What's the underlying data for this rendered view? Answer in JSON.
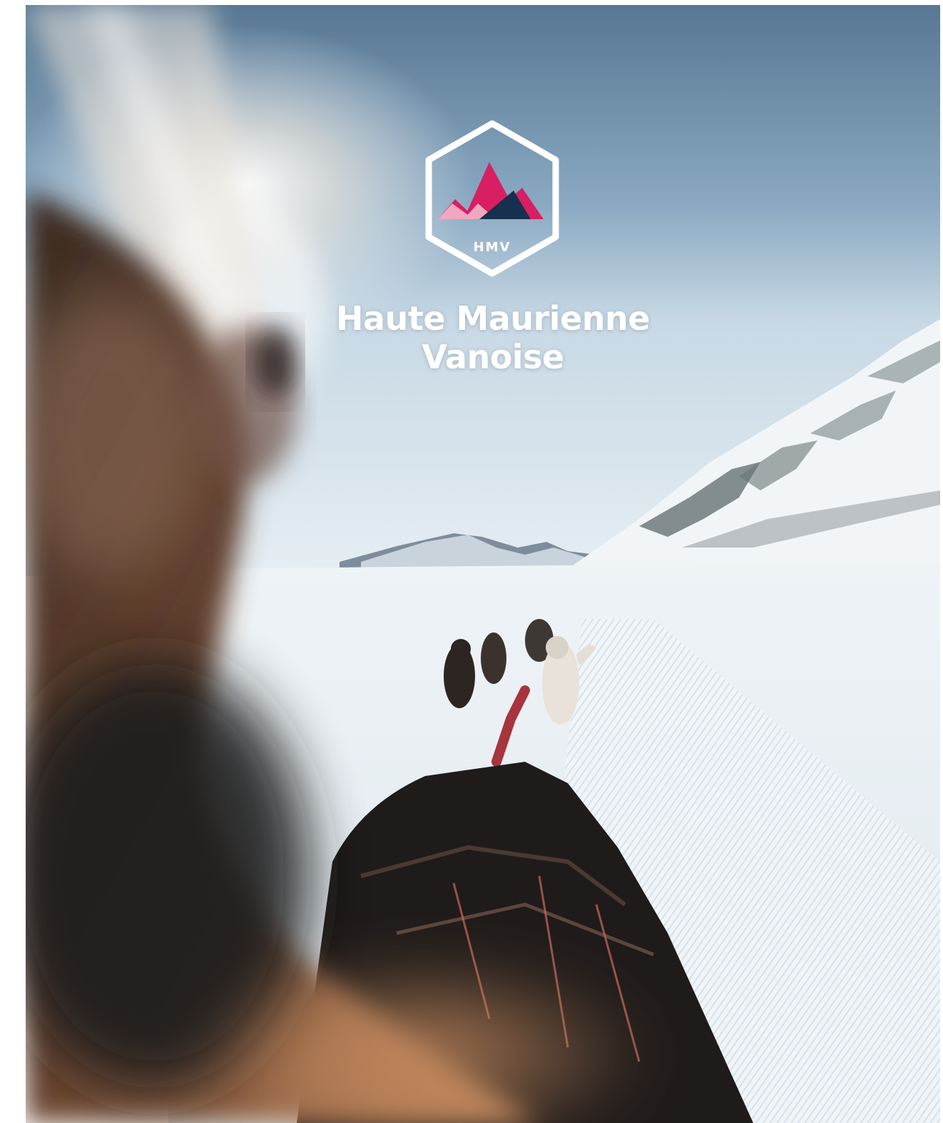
{
  "brand": {
    "badge_text": "HMV",
    "title_line1": "Haute Maurienne",
    "title_line2": "Vanoise"
  },
  "colors": {
    "peak_magenta": "#d81f63",
    "peak_pink": "#f2a7c0",
    "peak_navy": "#16304d",
    "badge_outline": "#ffffff"
  },
  "icons": {
    "logo": "hexagon-mountain-icon"
  }
}
